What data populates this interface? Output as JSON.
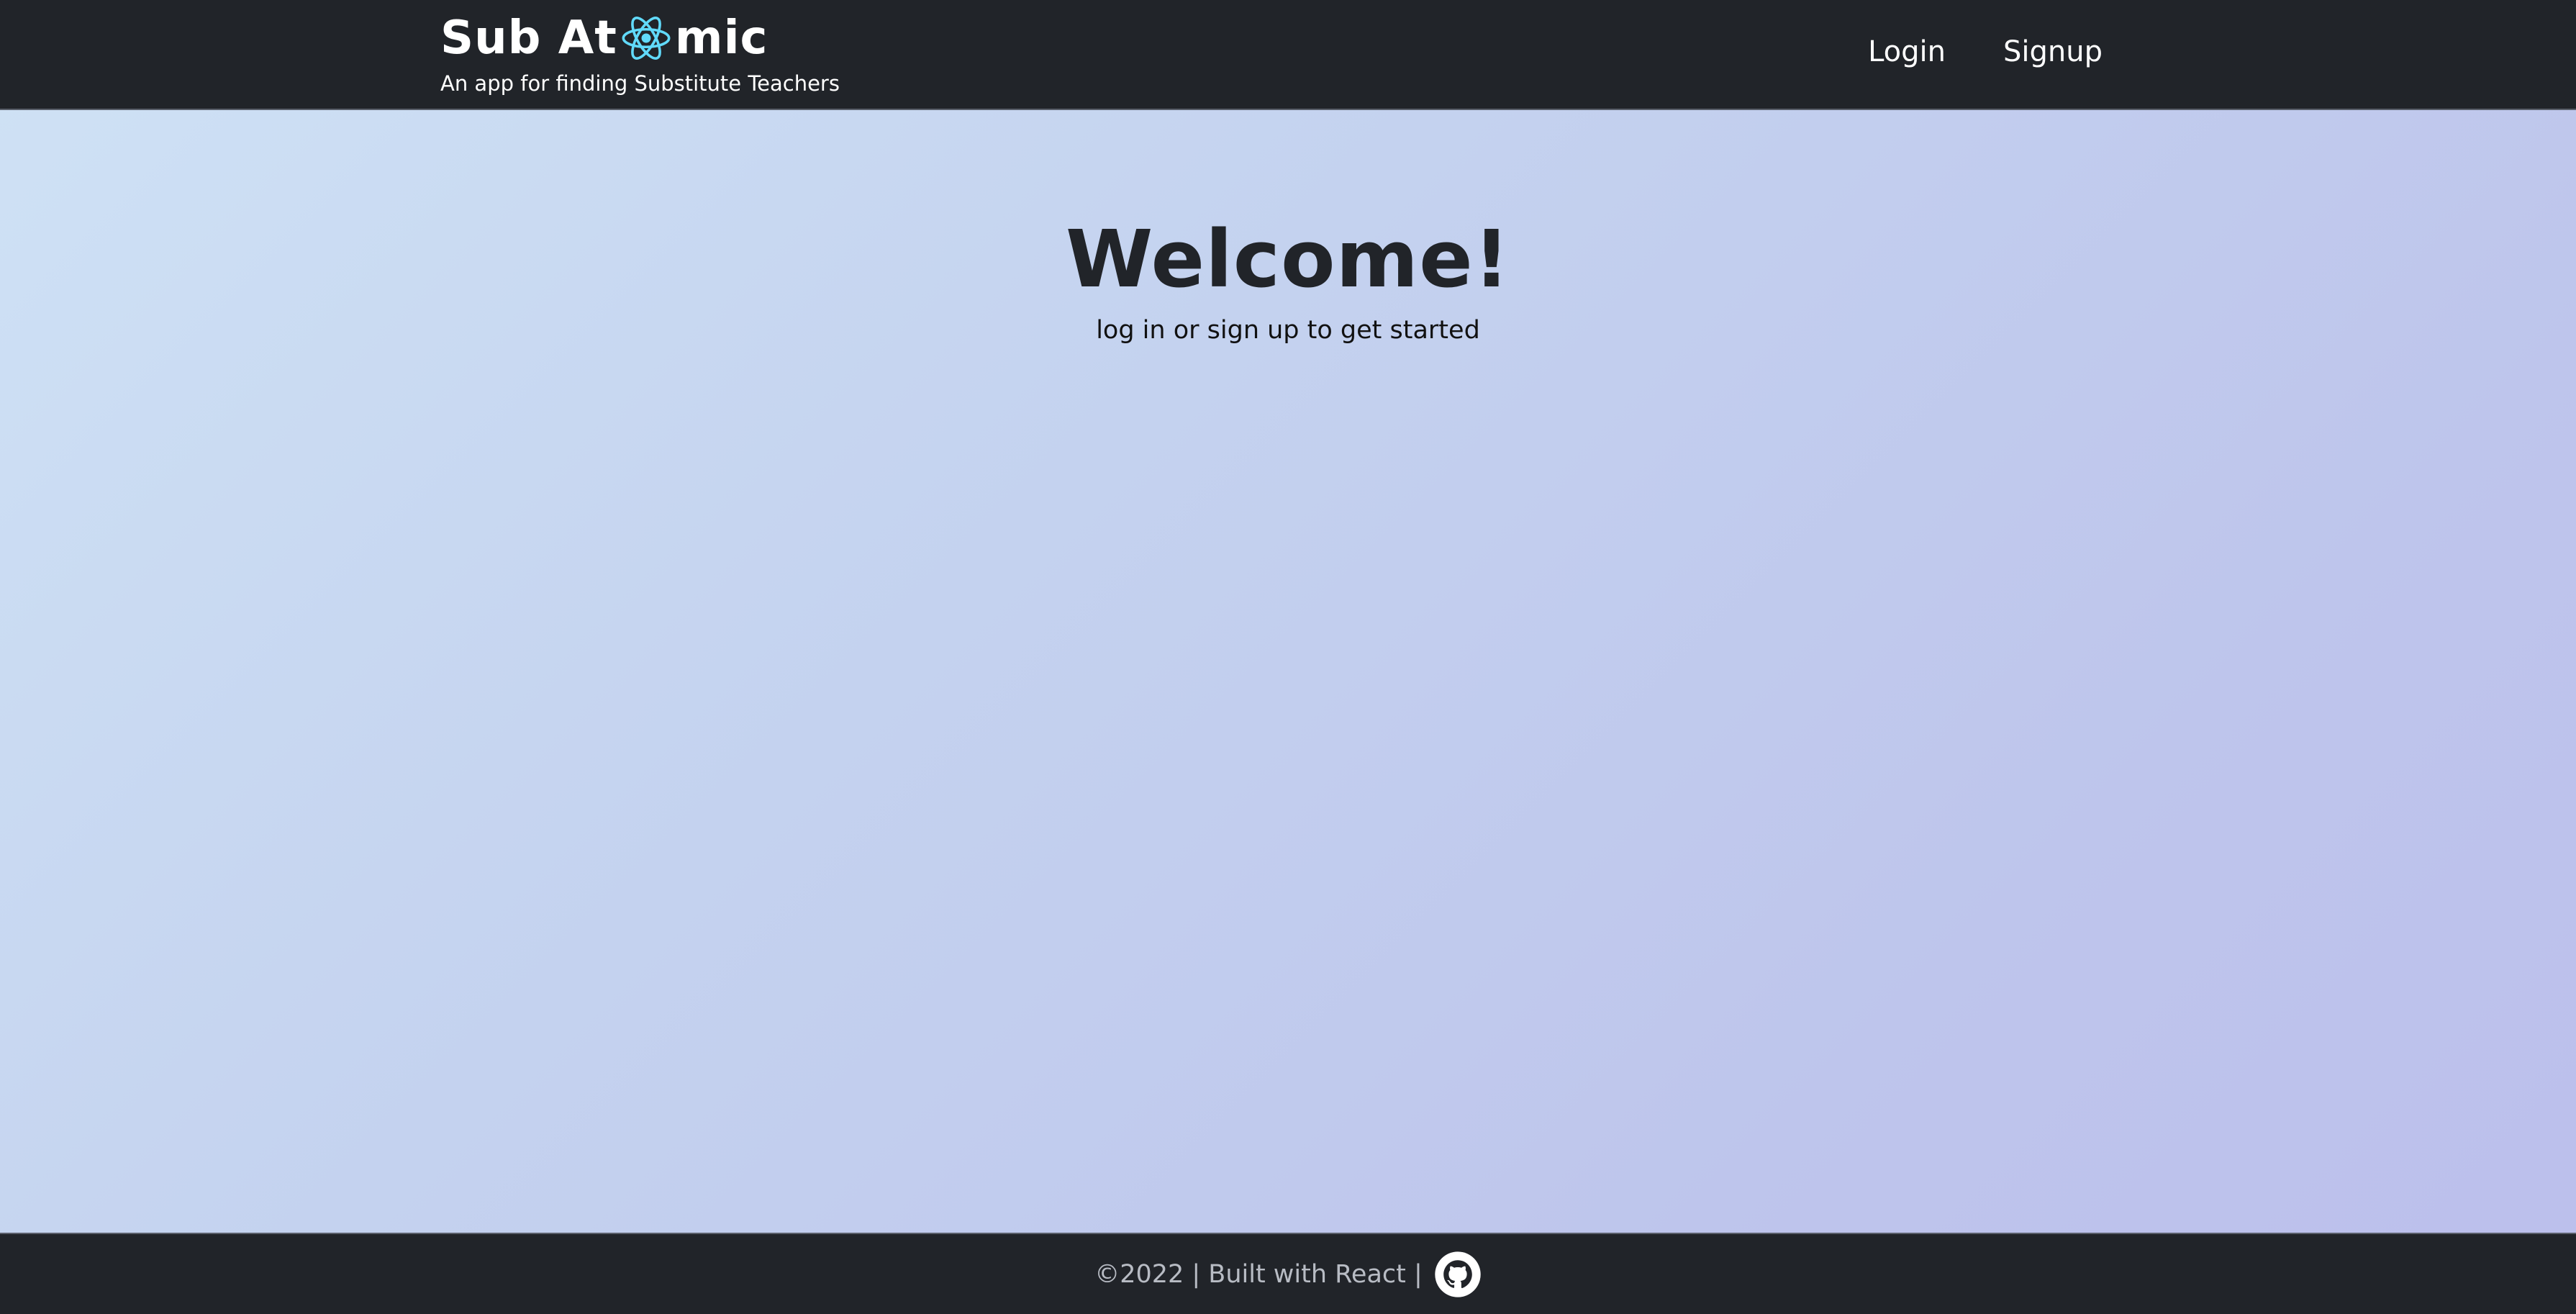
{
  "header": {
    "brand_prefix": "Sub At",
    "brand_suffix": "mic",
    "tagline": "An app for finding Substitute Teachers",
    "nav": {
      "login": "Login",
      "signup": "Signup"
    }
  },
  "main": {
    "heading": "Welcome!",
    "subheading": "log in or sign up to get started"
  },
  "footer": {
    "text": "©2022 | Built with React |",
    "icon": "github-icon"
  },
  "colors": {
    "bar_background": "#212429",
    "atom_accent": "#61dafb",
    "gradient_start": "#cfe2f5",
    "gradient_end": "#bcbfec"
  }
}
